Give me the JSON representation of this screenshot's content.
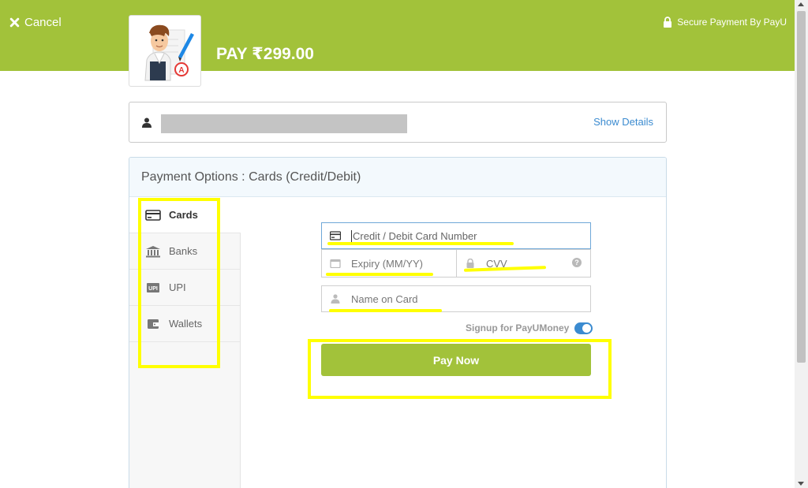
{
  "header": {
    "cancel_label": "Cancel",
    "pay_label": "PAY ₹299.00",
    "secure_label": "Secure Payment By PayU"
  },
  "user": {
    "show_details_label": "Show Details"
  },
  "payment": {
    "title": "Payment Options : Cards (Credit/Debit)",
    "methods": [
      {
        "label": "Cards",
        "icon": "card-icon",
        "active": true
      },
      {
        "label": "Banks",
        "icon": "bank-icon",
        "active": false
      },
      {
        "label": "UPI",
        "icon": "upi-icon",
        "active": false
      },
      {
        "label": "Wallets",
        "icon": "wallet-icon",
        "active": false
      }
    ]
  },
  "form": {
    "card_number_placeholder": "Credit / Debit Card Number",
    "expiry_placeholder": "Expiry (MM/YY)",
    "cvv_placeholder": "CVV",
    "cvv_help": "?",
    "name_placeholder": "Name on Card",
    "signup_label": "Signup for PayUMoney",
    "signup_enabled": true,
    "pay_button_label": "Pay Now",
    "upi_badge": "UPI"
  },
  "colors": {
    "brand_green": "#a2c23a",
    "link_blue": "#3b8bd0",
    "highlight_yellow": "#ffff00"
  }
}
